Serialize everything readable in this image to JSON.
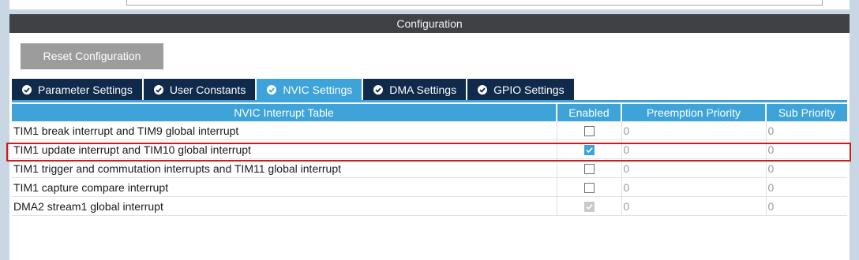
{
  "panel": {
    "title": "Configuration"
  },
  "toolbar": {
    "reset_label": "Reset Configuration"
  },
  "tabs": [
    {
      "label": "Parameter Settings",
      "active": false
    },
    {
      "label": "User Constants",
      "active": false
    },
    {
      "label": "NVIC Settings",
      "active": true
    },
    {
      "label": "DMA Settings",
      "active": false
    },
    {
      "label": "GPIO Settings",
      "active": false
    }
  ],
  "table": {
    "headers": [
      "NVIC Interrupt Table",
      "Enabled",
      "Preemption Priority",
      "Sub Priority"
    ],
    "rows": [
      {
        "name": "TIM1 break interrupt and TIM9 global interrupt",
        "enabled": false,
        "editable": true,
        "preemption": "0",
        "sub": "0"
      },
      {
        "name": "TIM1 update interrupt and TIM10 global interrupt",
        "enabled": true,
        "editable": true,
        "preemption": "0",
        "sub": "0"
      },
      {
        "name": "TIM1 trigger and commutation interrupts and TIM11 global interrupt",
        "enabled": false,
        "editable": true,
        "preemption": "0",
        "sub": "0"
      },
      {
        "name": "TIM1 capture compare interrupt",
        "enabled": false,
        "editable": true,
        "preemption": "0",
        "sub": "0"
      },
      {
        "name": "DMA2 stream1 global interrupt",
        "enabled": true,
        "editable": false,
        "preemption": "0",
        "sub": "0"
      }
    ]
  },
  "colors": {
    "tab_dark": "#0f2a4a",
    "accent": "#3da3d9",
    "header_bar": "#3f4145",
    "highlight": "#d11a1a"
  },
  "icons": {
    "tab_icon": "check-circle-icon"
  }
}
